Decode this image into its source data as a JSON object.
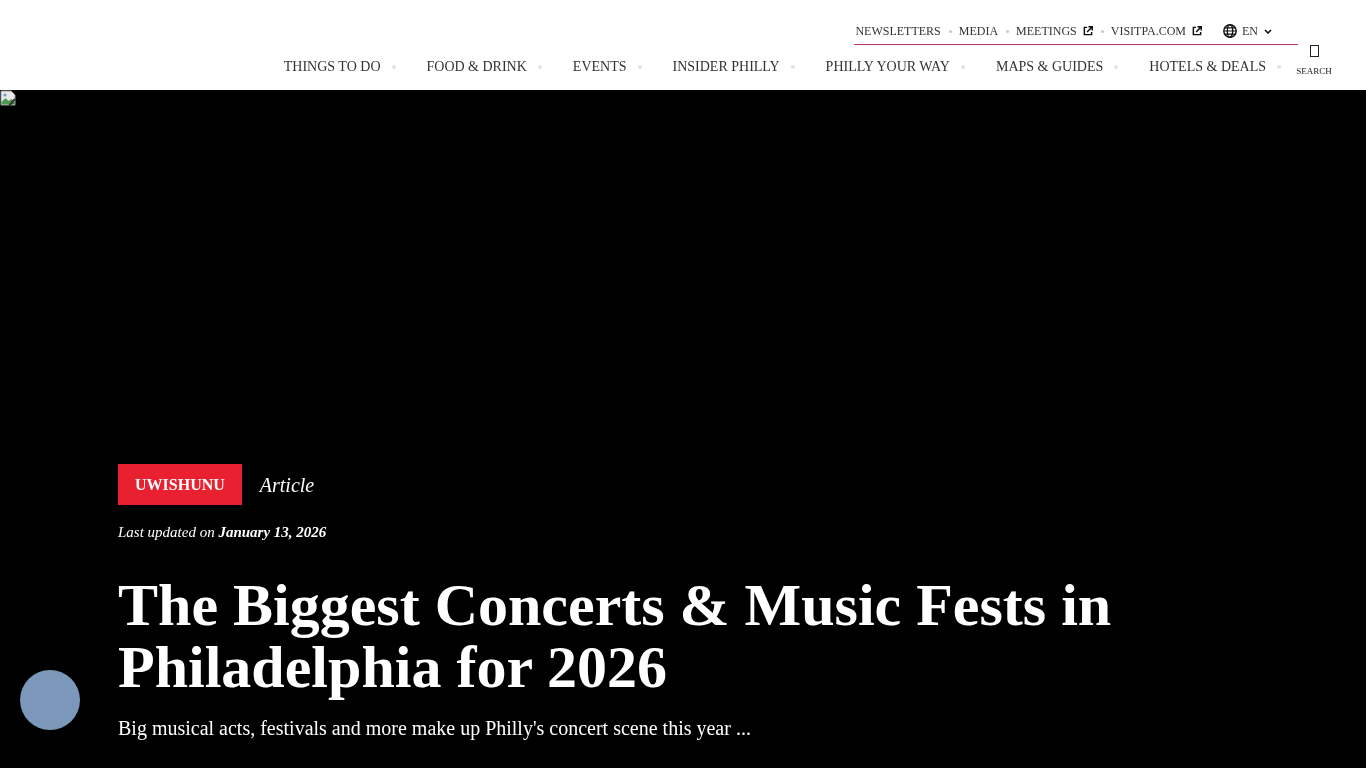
{
  "utility_nav": {
    "items": [
      {
        "label": "NEWSLETTERS",
        "external": false
      },
      {
        "label": "MEDIA",
        "external": false
      },
      {
        "label": "MEETINGS",
        "external": true
      },
      {
        "label": "VISITPA.COM",
        "external": true
      }
    ],
    "language": {
      "label": "EN"
    }
  },
  "main_nav": {
    "items": [
      {
        "label": "THINGS TO DO"
      },
      {
        "label": "FOOD & DRINK"
      },
      {
        "label": "EVENTS"
      },
      {
        "label": "INSIDER PHILLY"
      },
      {
        "label": "PHILLY YOUR WAY"
      },
      {
        "label": "MAPS & GUIDES"
      },
      {
        "label": "HOTELS & DEALS"
      }
    ]
  },
  "search": {
    "label": "SEARCH"
  },
  "hero": {
    "image_broken": true,
    "category": "UWISHUNU",
    "content_type": "Article",
    "updated": "Last updated on **January 13, 2026**",
    "title": "The Biggest Concerts & Music Fests in Philadelphia for 2026",
    "summary": "Big musical acts, festivals and more make up Philly's concert scene this year ..."
  }
}
